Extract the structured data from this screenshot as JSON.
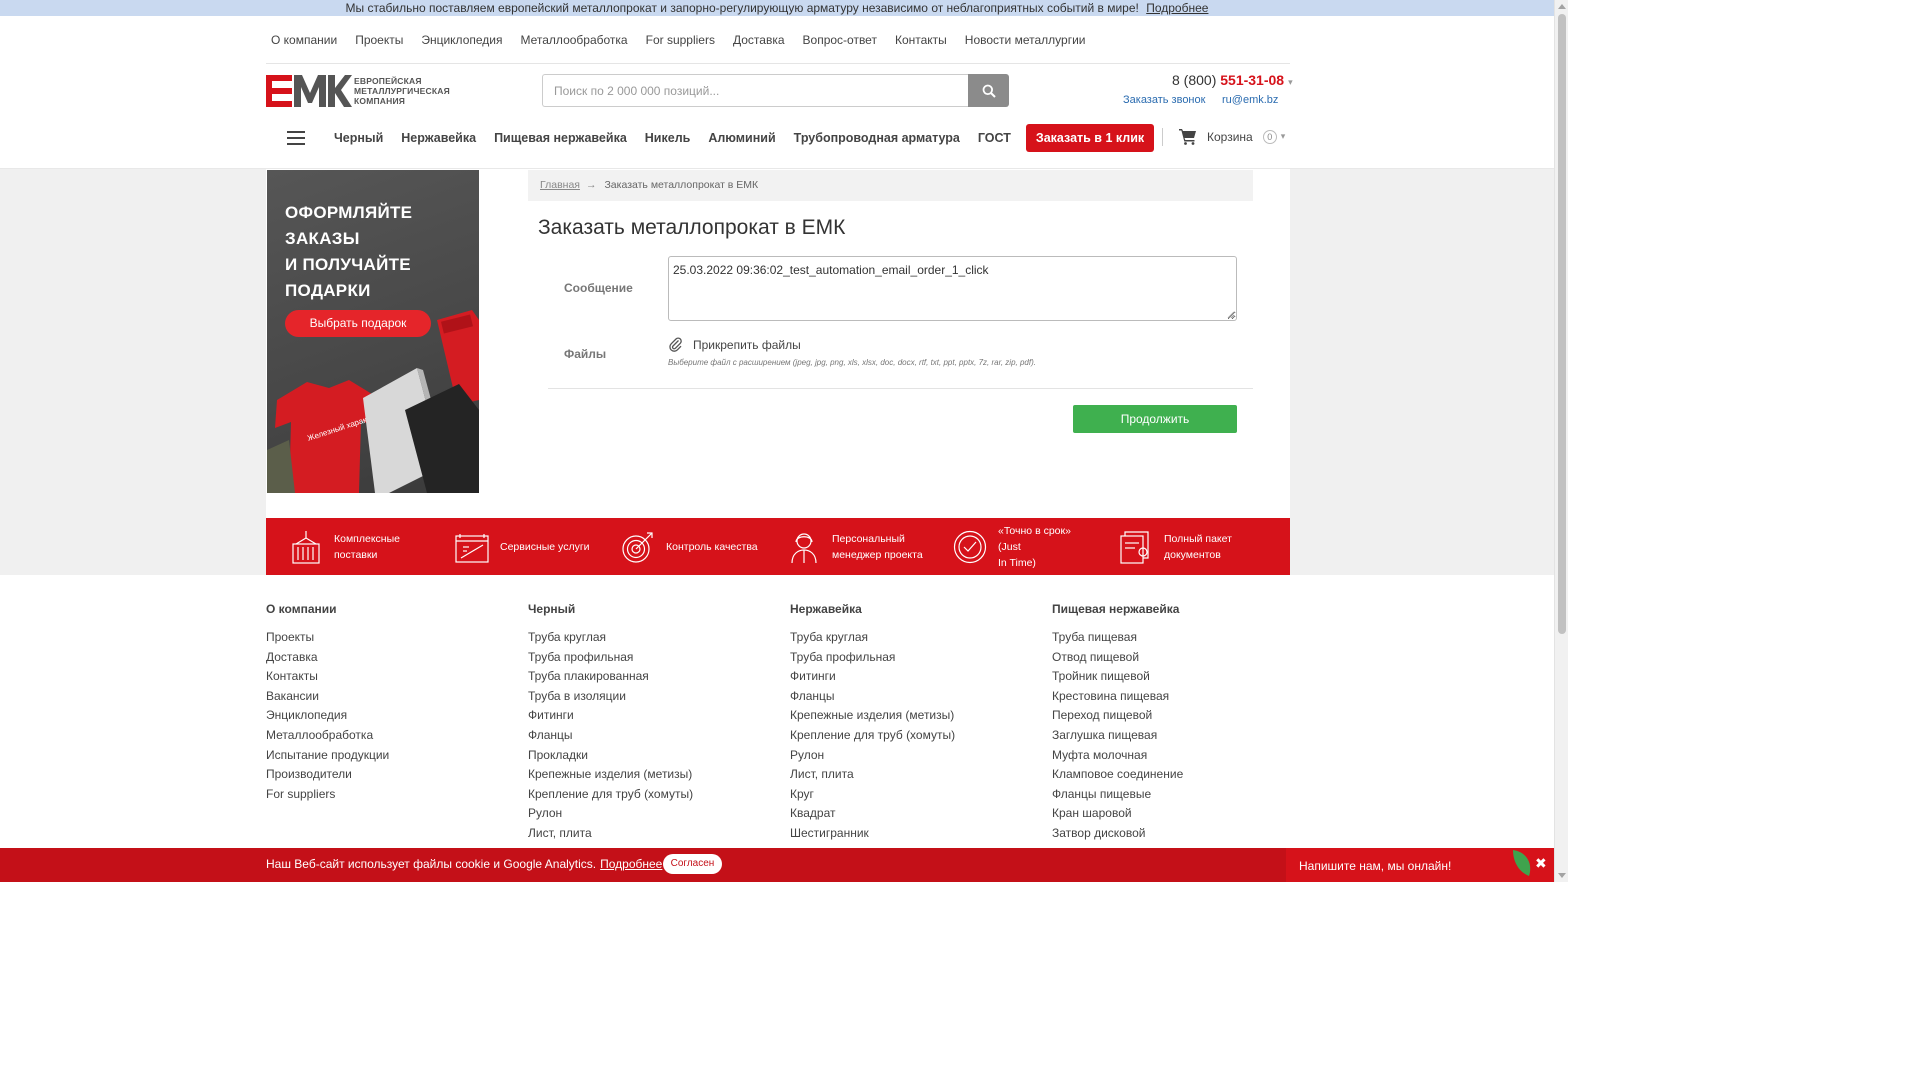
{
  "banner": {
    "text": "Мы стабильно поставляем европейский металлопрокат и запорно-регулирующую арматуру независимо от неблагоприятных событий в мире!",
    "link": "Подробнее"
  },
  "top_nav": [
    "О компании",
    "Проекты",
    "Энциклопедия",
    "Металлообработка",
    "For suppliers",
    "Доставка",
    "Вопрос-ответ",
    "Контакты",
    "Новости металлургии"
  ],
  "logo": {
    "mark": "ЕМК",
    "line1": "ЕВРОПЕЙСКАЯ",
    "line2": "МЕТАЛЛУРГИЧЕСКАЯ",
    "line3": "КОМПАНИЯ"
  },
  "search": {
    "placeholder": "Поиск по 2 000 000 позиций..."
  },
  "contact": {
    "phone_prefix": "8 (800) ",
    "phone_main": "551-31-08",
    "call_link": "Заказать звонок",
    "email": "ru@emk.bz"
  },
  "categories": [
    "Черный",
    "Нержавейка",
    "Пищевая нержавейка",
    "Никель",
    "Алюминий",
    "Трубопроводная арматура",
    "ГОСТ"
  ],
  "order_button": "Заказать в 1 клик",
  "cart": {
    "label": "Корзина",
    "count": "0"
  },
  "promo": {
    "line1": "ОФОРМЛЯЙТЕ",
    "line2": "ЗАКАЗЫ",
    "line3": "И ПОЛУЧАЙТЕ",
    "line4": "ПОДАРКИ",
    "button": "Выбрать подарок",
    "shirt_text": "Железный характер"
  },
  "breadcrumb": {
    "home": "Главная",
    "arrow": "→",
    "current": "Заказать металлопрокат в ЕМК"
  },
  "page_title": "Заказать металлопрокат в ЕМК",
  "form": {
    "message_label": "Сообщение",
    "message_value": "25.03.2022 09:36:02_test_automation_email_order_1_click",
    "files_label": "Файлы",
    "attach_label": "Прикрепить файлы",
    "attach_hint": "Выберите файл с расширением (jpeg, jpg, png, xls, xlsx, doc, docx, rtf, txt, ppt, pptx, 7z, rar, zip, pdf).",
    "continue_button": "Продолжить"
  },
  "features": [
    {
      "icon": "container-icon",
      "line1": "Комплексные",
      "line2": "поставки"
    },
    {
      "icon": "truck-doc-icon",
      "line1": "Сервисные услуги",
      "line2": ""
    },
    {
      "icon": "target-icon",
      "line1": "Контроль качества",
      "line2": ""
    },
    {
      "icon": "manager-icon",
      "line1": "Персональный",
      "line2": "менеджер проекта"
    },
    {
      "icon": "clock-icon",
      "line1": "«Точно в срок» (Just",
      "line2": "In Time)"
    },
    {
      "icon": "documents-icon",
      "line1": "Полный пакет",
      "line2": "документов"
    }
  ],
  "footer": {
    "col1": {
      "heading": "О компании",
      "links": [
        "Проекты",
        "Доставка",
        "Контакты",
        "Вакансии",
        "Энциклопедия",
        "Металлообработка",
        "Испытание продукции",
        "Производители",
        "For suppliers"
      ]
    },
    "col2": {
      "heading": "Черный",
      "links": [
        "Труба круглая",
        "Труба профильная",
        "Труба плакированная",
        "Труба в изоляции",
        "Фитинги",
        "Фланцы",
        "Прокладки",
        "Крепежные изделия (метизы)",
        "Крепление для труб (хомуты)",
        "Рулон",
        "Лист, плита"
      ]
    },
    "col3": {
      "heading": "Нержавейка",
      "links": [
        "Труба круглая",
        "Труба профильная",
        "Фитинги",
        "Фланцы",
        "Крепежные изделия (метизы)",
        "Крепление для труб (хомуты)",
        "Рулон",
        "Лист, плита",
        "Круг",
        "Квадрат",
        "Шестигранник"
      ]
    },
    "col4": {
      "heading": "Пищевая нержавейка",
      "links": [
        "Труба пищевая",
        "Отвод пищевой",
        "Тройник пищевой",
        "Крестовина пищевая",
        "Переход пищевой",
        "Заглушка пищевая",
        "Муфта молочная",
        "Кламповое соединение",
        "Фланцы пищевые",
        "Кран шаровой",
        "Затвор дисковой"
      ]
    }
  },
  "cookie": {
    "text": "Наш Веб-сайт использует файлы cookie и Google Analytics.",
    "link": "Подробнее",
    "button": "Согласен"
  },
  "chat": {
    "text": "Напишите нам, мы онлайн!",
    "close": "✖"
  },
  "colors": {
    "brand_red": "#d6121a",
    "continue_green": "#3fb04f",
    "link_blue": "#2b6cb0",
    "banner_blue": "#c9d9f0"
  }
}
